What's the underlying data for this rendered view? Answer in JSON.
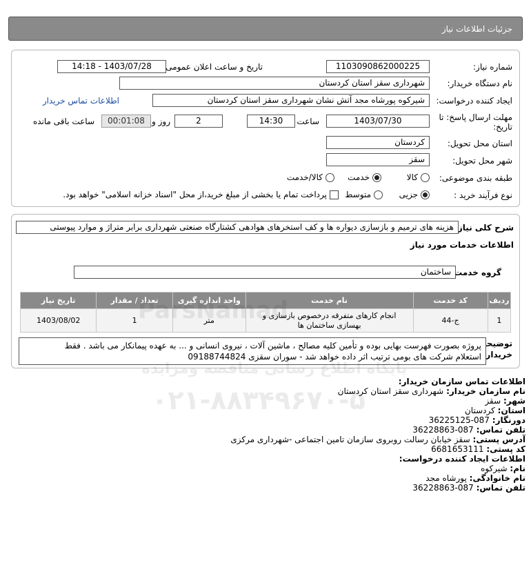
{
  "header": {
    "title": "جزئیات اطلاعات نیاز"
  },
  "form": {
    "need_number_label": "شماره نیاز:",
    "need_number": "1103090862000225",
    "announce_label": "تاریخ و ساعت اعلان عمومی:",
    "announce_value": "1403/07/28 - 14:18",
    "buyer_org_label": "نام دستگاه خریدار:",
    "buyer_org": "شهرداری سقز استان کردستان",
    "creator_label": "ایجاد کننده درخواست:",
    "creator": "شیرکوه پورشاه مجد آتش نشان شهرداری سقز استان کردستان",
    "buyer_contact_link": "اطلاعات تماس خریدار",
    "deadline_label_1": "مهلت ارسال پاسخ: تا",
    "deadline_label_2": "تاریخ:",
    "deadline_date": "1403/07/30",
    "time_label": "ساعت",
    "deadline_time": "14:30",
    "days_value": "2",
    "days_label": "روز و",
    "remaining_time": "00:01:08",
    "remaining_label": "ساعت باقی مانده",
    "province_label": "استان محل تحویل:",
    "province": "کردستان",
    "city_label": "شهر محل تحویل:",
    "city": "سقز",
    "category_label": "طبقه بندی موضوعی:",
    "category_options": [
      "کالا",
      "خدمت",
      "کالا/خدمت"
    ],
    "category_selected": 1,
    "process_label": "نوع فرآیند خرید :",
    "process_options": [
      "جزیی",
      "متوسط"
    ],
    "process_selected": 0,
    "payment_note": "پرداخت تمام یا بخشی از مبلغ خرید،از محل \"اسناد خزانه اسلامی\" خواهد بود."
  },
  "summary": {
    "label": "شرح کلی نیاز:",
    "text": "هزینه های ترمیم و بازسازی دیواره ها و کف استخرهای هوادهی کشتارگاه صنعتی شهرداری برابر متراژ و موارد پیوستی",
    "services_title": "اطلاعات خدمات مورد نیاز",
    "group_label": "گروه خدمت:",
    "group_value": "ساختمان"
  },
  "table": {
    "headers": [
      "ردیف",
      "کد خدمت",
      "نام خدمت",
      "واحد اندازه گیری",
      "تعداد / مقدار",
      "تاریخ نیاز"
    ],
    "rows": [
      [
        "1",
        "ج-44",
        "انجام کارهای متفرقه درخصوص بازسازی و بهسازی ساختمان ها",
        "متر",
        "1",
        "1403/08/02"
      ]
    ]
  },
  "buyer_desc": {
    "label_1": "توضیحات",
    "label_2": "خریدار:",
    "line1": "پروژه بصورت فهرست بهایی بوده و تأمین کلیه مصالح ، ماشین آلات ، نیروی انسانی و ... به عهده پیمانکار می باشد . فقط",
    "line2": "استعلام شرکت های بومی ترتیب اثر داده خواهد شد - سوران سقزی 09188744824"
  },
  "contact": {
    "org_title": "اطلاعات تماس سازمان خریدار:",
    "org_name_label": "نام سازمان خریدار:",
    "org_name": "شهرداری سقز استان کردستان",
    "city_label": "شهر:",
    "city": "سقز",
    "province_label": "استان:",
    "province": "کردستان",
    "fax_label": "دورنگار:",
    "fax": "087-36225125",
    "phone_label": "تلفن تماس:",
    "phone": "087-36228863",
    "address_label": "آدرس پستی:",
    "address": "سقز خیابان رسالت روبروی سازمان تامین اجتماعی -شهرداری مرکزی",
    "postal_label": "کد پستی:",
    "postal": "6681653111",
    "creator_title": "اطلاعات ایجاد کننده درخواست:",
    "first_name_label": "نام:",
    "first_name": "شیرکوه",
    "last_name_label": "نام خانوادگی:",
    "last_name": "پورشاه مجد",
    "creator_phone_label": "تلفن تماس:",
    "creator_phone": "087-36228863"
  },
  "watermark": {
    "brand": "ParsNamad",
    "line": "پایگاه اطلاع رسانی مناقصه ومزایده",
    "phone": "۰۲۱-۸۸۳۴۹۶۷۰-۵"
  }
}
